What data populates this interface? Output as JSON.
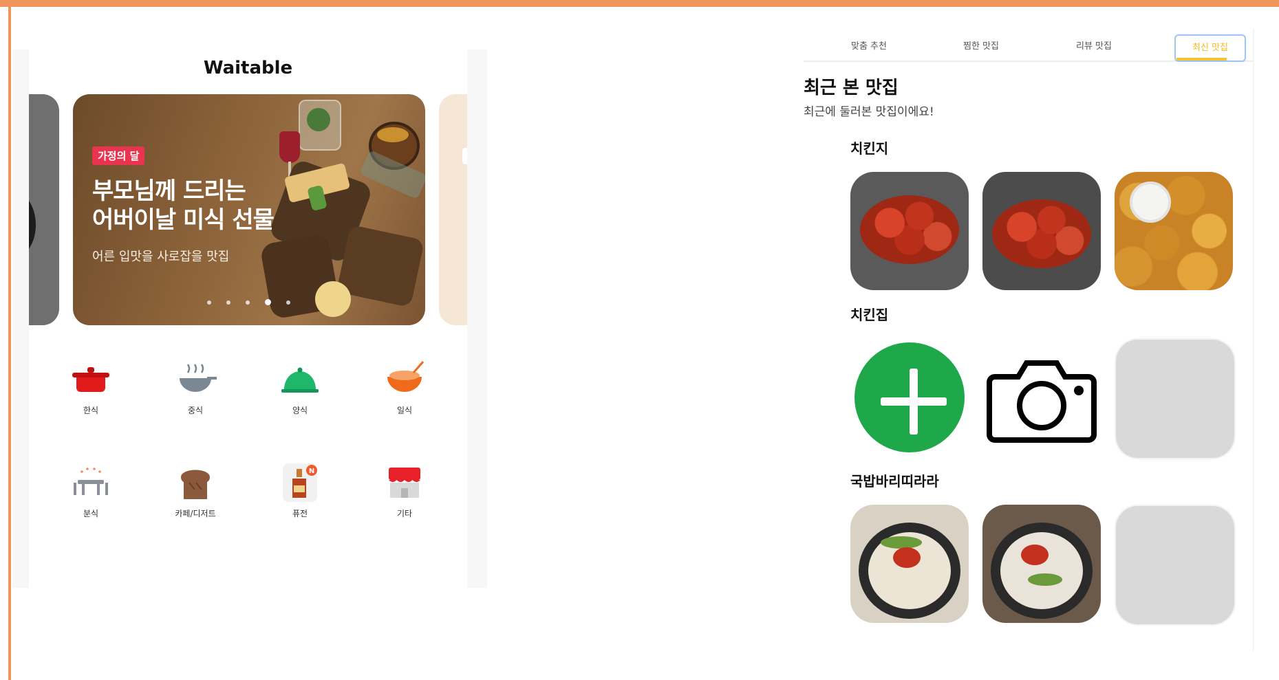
{
  "left_app": {
    "title": "Waitable",
    "banner": {
      "badge": "가정의 달",
      "headline_line1": "부모님께 드리는",
      "headline_line2": "어버이날 미식 선물",
      "subtitle": "어른 입맛을 사로잡을 맛집",
      "active_slide": 4,
      "slide_count": 5
    },
    "categories": [
      {
        "label": "한식",
        "icon": "pot-icon"
      },
      {
        "label": "중식",
        "icon": "steaming-bowl-icon"
      },
      {
        "label": "양식",
        "icon": "cloche-icon"
      },
      {
        "label": "일식",
        "icon": "rice-bowl-icon"
      },
      {
        "label": "분식",
        "icon": "table-icon"
      },
      {
        "label": "카페/디저트",
        "icon": "bread-icon"
      },
      {
        "label": "퓨전",
        "icon": "sauce-bottle-icon",
        "badge": "N"
      },
      {
        "label": "기타",
        "icon": "storefront-icon"
      }
    ]
  },
  "right_app": {
    "tabs": [
      {
        "label": "맞춤 추천",
        "active": false
      },
      {
        "label": "찜한 맛집",
        "active": false
      },
      {
        "label": "리뷰 맛집",
        "active": false
      },
      {
        "label": "최신 맛집",
        "active": true
      }
    ],
    "section_title": "최근 본 맛집",
    "section_subtitle": "최근에 둘러본 맛집이에요!",
    "groups": [
      {
        "name": "치킨지"
      },
      {
        "name": "치킨집"
      },
      {
        "name": "국밥바리띠라라"
      }
    ]
  },
  "colors": {
    "frame": "#f0955c",
    "badge": "#e8344f",
    "active_tab": "#f5b820",
    "plus_green": "#1fa84a"
  }
}
